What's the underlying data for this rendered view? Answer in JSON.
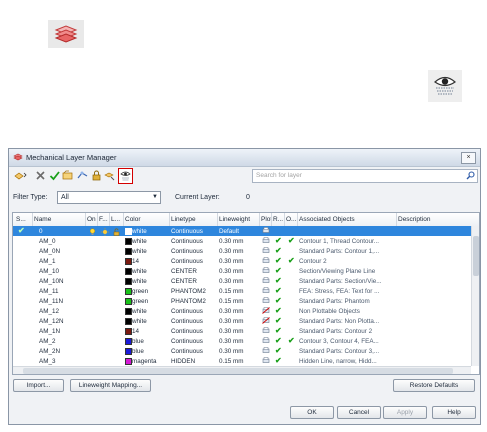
{
  "dialog": {
    "title": "Mechanical Layer Manager",
    "close_glyph": "×",
    "search": {
      "placeholder": "Search for layer"
    },
    "filter": {
      "label": "Filter Type:",
      "value": "All"
    },
    "current_layer": {
      "label": "Current Layer:",
      "value": "0"
    }
  },
  "grid": {
    "columns": [
      "S...",
      "Name",
      "On",
      "F...",
      "L...",
      "Color",
      "Linetype",
      "Lineweight",
      "Plot",
      "R...",
      "O...",
      "Associated Objects",
      "Description"
    ],
    "rows": [
      {
        "name": "0",
        "color": "white",
        "swatch": "#ffffff",
        "linetype": "Continuous",
        "lineweight": "Default",
        "r": false,
        "o": false,
        "assoc": "",
        "current": true
      },
      {
        "name": "AM_0",
        "color": "white",
        "swatch": "#000000",
        "linetype": "Continuous",
        "lineweight": "0.30 mm",
        "r": true,
        "o": true,
        "assoc": "Contour 1, Thread Contour..."
      },
      {
        "name": "AM_0N",
        "color": "white",
        "swatch": "#000000",
        "linetype": "Continuous",
        "lineweight": "0.30 mm",
        "r": true,
        "o": false,
        "assoc": "Standard Parts: Contour 1,..."
      },
      {
        "name": "AM_1",
        "color": "14",
        "swatch": "#7a1a10",
        "linetype": "Continuous",
        "lineweight": "0.30 mm",
        "r": true,
        "o": true,
        "assoc": "Contour 2"
      },
      {
        "name": "AM_10",
        "color": "white",
        "swatch": "#000000",
        "linetype": "CENTER",
        "lineweight": "0.30 mm",
        "r": true,
        "o": false,
        "assoc": "Section/Viewing Plane Line"
      },
      {
        "name": "AM_10N",
        "color": "white",
        "swatch": "#000000",
        "linetype": "CENTER",
        "lineweight": "0.30 mm",
        "r": true,
        "o": false,
        "assoc": "Standard Parts: Section/Vie..."
      },
      {
        "name": "AM_11",
        "color": "green",
        "swatch": "#19c219",
        "linetype": "PHANTOM2",
        "lineweight": "0.15 mm",
        "r": true,
        "o": false,
        "assoc": "FEA: Stress, FEA: Text for ..."
      },
      {
        "name": "AM_11N",
        "color": "green",
        "swatch": "#19c219",
        "linetype": "PHANTOM2",
        "lineweight": "0.15 mm",
        "r": true,
        "o": false,
        "assoc": "Standard Parts: Phantom"
      },
      {
        "name": "AM_12",
        "color": "white",
        "swatch": "#000000",
        "linetype": "Continuous",
        "lineweight": "0.30 mm",
        "r": true,
        "o": false,
        "assoc": "Non Plottable Objects",
        "noplot": true
      },
      {
        "name": "AM_12N",
        "color": "white",
        "swatch": "#000000",
        "linetype": "Continuous",
        "lineweight": "0.30 mm",
        "r": true,
        "o": false,
        "assoc": "Standard Parts: Non Plotta...",
        "noplot": true
      },
      {
        "name": "AM_1N",
        "color": "14",
        "swatch": "#7a1a10",
        "linetype": "Continuous",
        "lineweight": "0.30 mm",
        "r": true,
        "o": false,
        "assoc": "Standard Parts: Contour 2"
      },
      {
        "name": "AM_2",
        "color": "blue",
        "swatch": "#1a1ad9",
        "linetype": "Continuous",
        "lineweight": "0.30 mm",
        "r": true,
        "o": true,
        "assoc": "Contour 3, Contour 4, FEA..."
      },
      {
        "name": "AM_2N",
        "color": "blue",
        "swatch": "#1a1ad9",
        "linetype": "Continuous",
        "lineweight": "0.30 mm",
        "r": true,
        "o": false,
        "assoc": "Standard Parts: Contour 3,..."
      },
      {
        "name": "AM_3",
        "color": "magenta",
        "swatch": "#d419d4",
        "linetype": "HIDDEN",
        "lineweight": "0.15 mm",
        "r": true,
        "o": false,
        "assoc": "Hidden Line, narrow, Hidd..."
      }
    ]
  },
  "buttons": {
    "import": "Import...",
    "lineweight_mapping": "Lineweight Mapping...",
    "restore": "Restore Defaults",
    "ok": "OK",
    "cancel": "Cancel",
    "apply": "Apply",
    "help": "Help"
  },
  "icons": [
    "layers-icon",
    "eye-icon",
    "new-layer-icon",
    "delete-icon",
    "set-current-icon",
    "layer-states-icon",
    "freeze-icon",
    "lock-icon",
    "search-icon"
  ]
}
